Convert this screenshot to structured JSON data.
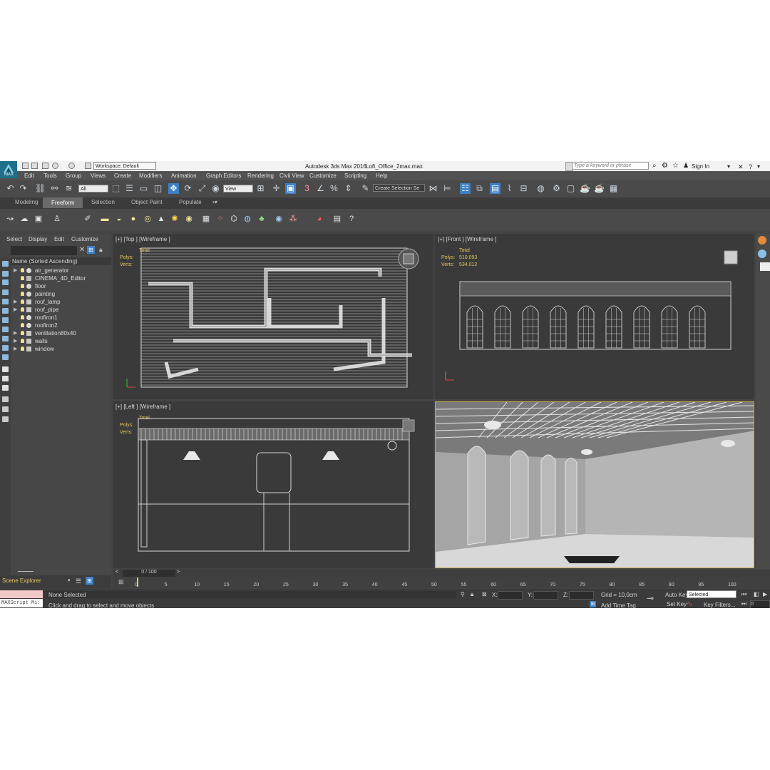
{
  "window": {
    "app_title": "Autodesk 3ds Max 2016",
    "file_name": "Loft_Office_2max.max",
    "workspace": "Workspace: Default",
    "search_placeholder": "Type a keyword or phrase",
    "sign_in": "Sign In",
    "logo_text": "MAX"
  },
  "menu": [
    "Edit",
    "Tools",
    "Group",
    "Views",
    "Create",
    "Modifiers",
    "Animation",
    "Graph Editors",
    "Rendering",
    "Civil View",
    "Customize",
    "Scripting",
    "Help"
  ],
  "toolbar": {
    "filter_value": "All",
    "ref_coord_value": "View",
    "selection_set_placeholder": "Create Selection Se"
  },
  "ribbon_tabs": [
    "Modeling",
    "Freeform",
    "Selection",
    "Object Paint",
    "Populate"
  ],
  "ribbon_active": "Freeform",
  "explorer": {
    "tabs": [
      "Select",
      "Display",
      "Edit",
      "Customize"
    ],
    "header": "Name (Sorted Ascending)",
    "items": [
      {
        "name": "air_generator",
        "expand": "▶"
      },
      {
        "name": "CINEMA_4D_Editor",
        "expand": ""
      },
      {
        "name": "floor",
        "expand": ""
      },
      {
        "name": "painting",
        "expand": ""
      },
      {
        "name": "roof_lamp",
        "expand": "▶"
      },
      {
        "name": "roof_pipe",
        "expand": "▶"
      },
      {
        "name": "roofiron1",
        "expand": ""
      },
      {
        "name": "roofiron2",
        "expand": ""
      },
      {
        "name": "ventilation80x40",
        "expand": "▶"
      },
      {
        "name": "walls",
        "expand": "▶"
      },
      {
        "name": "window",
        "expand": "▶"
      }
    ],
    "footer_label": "Scene Explorer"
  },
  "viewports": {
    "top": {
      "label": "[+] [Top ] [Wireframe ]"
    },
    "front": {
      "label": "[+] [Front ] [Wireframe ]",
      "total": "Total",
      "polys_label": "Polys:",
      "polys": "510.093",
      "verts_label": "Verts:",
      "verts": "534.012"
    },
    "left": {
      "label": "[+] [Left ] [Wireframe ]"
    },
    "persp": {
      "label": "[+] [Perspective ]"
    }
  },
  "stats": {
    "total": "Total",
    "polys_label": "Polys:",
    "verts_label": "Verts:"
  },
  "timeline": {
    "frame_readout": "0 / 100",
    "ticks": [
      "0",
      "5",
      "10",
      "15",
      "20",
      "25",
      "30",
      "35",
      "40",
      "45",
      "50",
      "55",
      "60",
      "65",
      "70",
      "75",
      "80",
      "85",
      "90",
      "95",
      "100"
    ]
  },
  "status": {
    "maxscript": "MAXScript Mi:",
    "selection": "None Selected",
    "prompt": "Click and drag to select and move objects",
    "x_label": "X:",
    "y_label": "Y:",
    "z_label": "Z:",
    "grid": "Grid = 10,0cm",
    "add_time_tag": "Add Time Tag",
    "auto_key": "Auto Key",
    "set_key": "Set Key",
    "selected": "Selected",
    "key_filters": "Key Filters...",
    "frame": "0"
  },
  "colors": {
    "accent": "#3d7fc4",
    "stat": "#e2c85a",
    "persp_border": "#c7a94a"
  }
}
